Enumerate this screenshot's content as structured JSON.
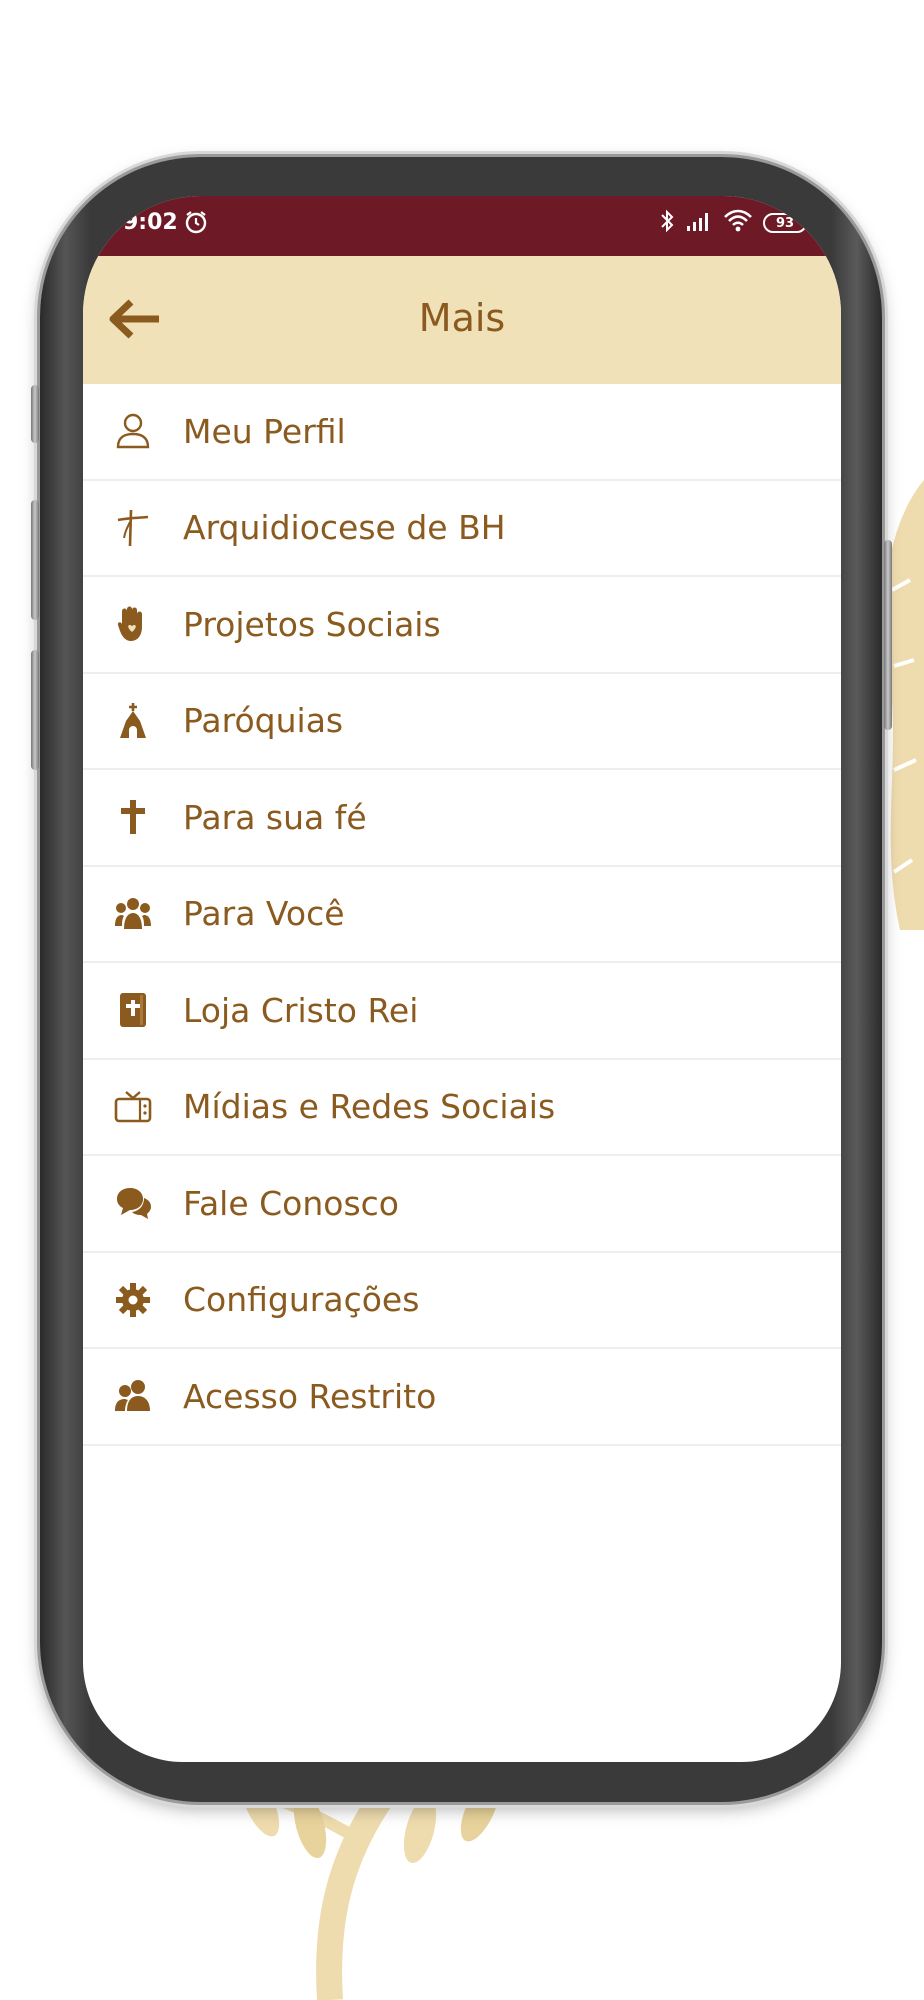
{
  "colors": {
    "status_bar": "#6e1a26",
    "header_bg": "#f1e1b8",
    "accent": "#8a5a1e",
    "divider": "#eeeeee"
  },
  "status_bar": {
    "time": "9:02",
    "battery": "93",
    "icons": [
      "alarm-icon",
      "bluetooth-icon",
      "signal-icon",
      "wifi-icon",
      "battery-icon"
    ]
  },
  "header": {
    "title": "Mais",
    "back_icon": "back-arrow-icon"
  },
  "menu": {
    "items": [
      {
        "label": "Meu Perfil",
        "icon": "user-icon"
      },
      {
        "label": "Arquidiocese de BH",
        "icon": "crucifix-icon"
      },
      {
        "label": "Projetos Sociais",
        "icon": "hand-heart-icon"
      },
      {
        "label": "Paróquias",
        "icon": "church-icon"
      },
      {
        "label": "Para sua fé",
        "icon": "cross-icon"
      },
      {
        "label": "Para Você",
        "icon": "group-icon"
      },
      {
        "label": "Loja Cristo Rei",
        "icon": "bible-icon"
      },
      {
        "label": "Mídias e Redes Sociais",
        "icon": "tv-icon"
      },
      {
        "label": "Fale Conosco",
        "icon": "chat-icon"
      },
      {
        "label": "Configurações",
        "icon": "gear-icon"
      },
      {
        "label": "Acesso Restrito",
        "icon": "users-icon"
      }
    ]
  }
}
